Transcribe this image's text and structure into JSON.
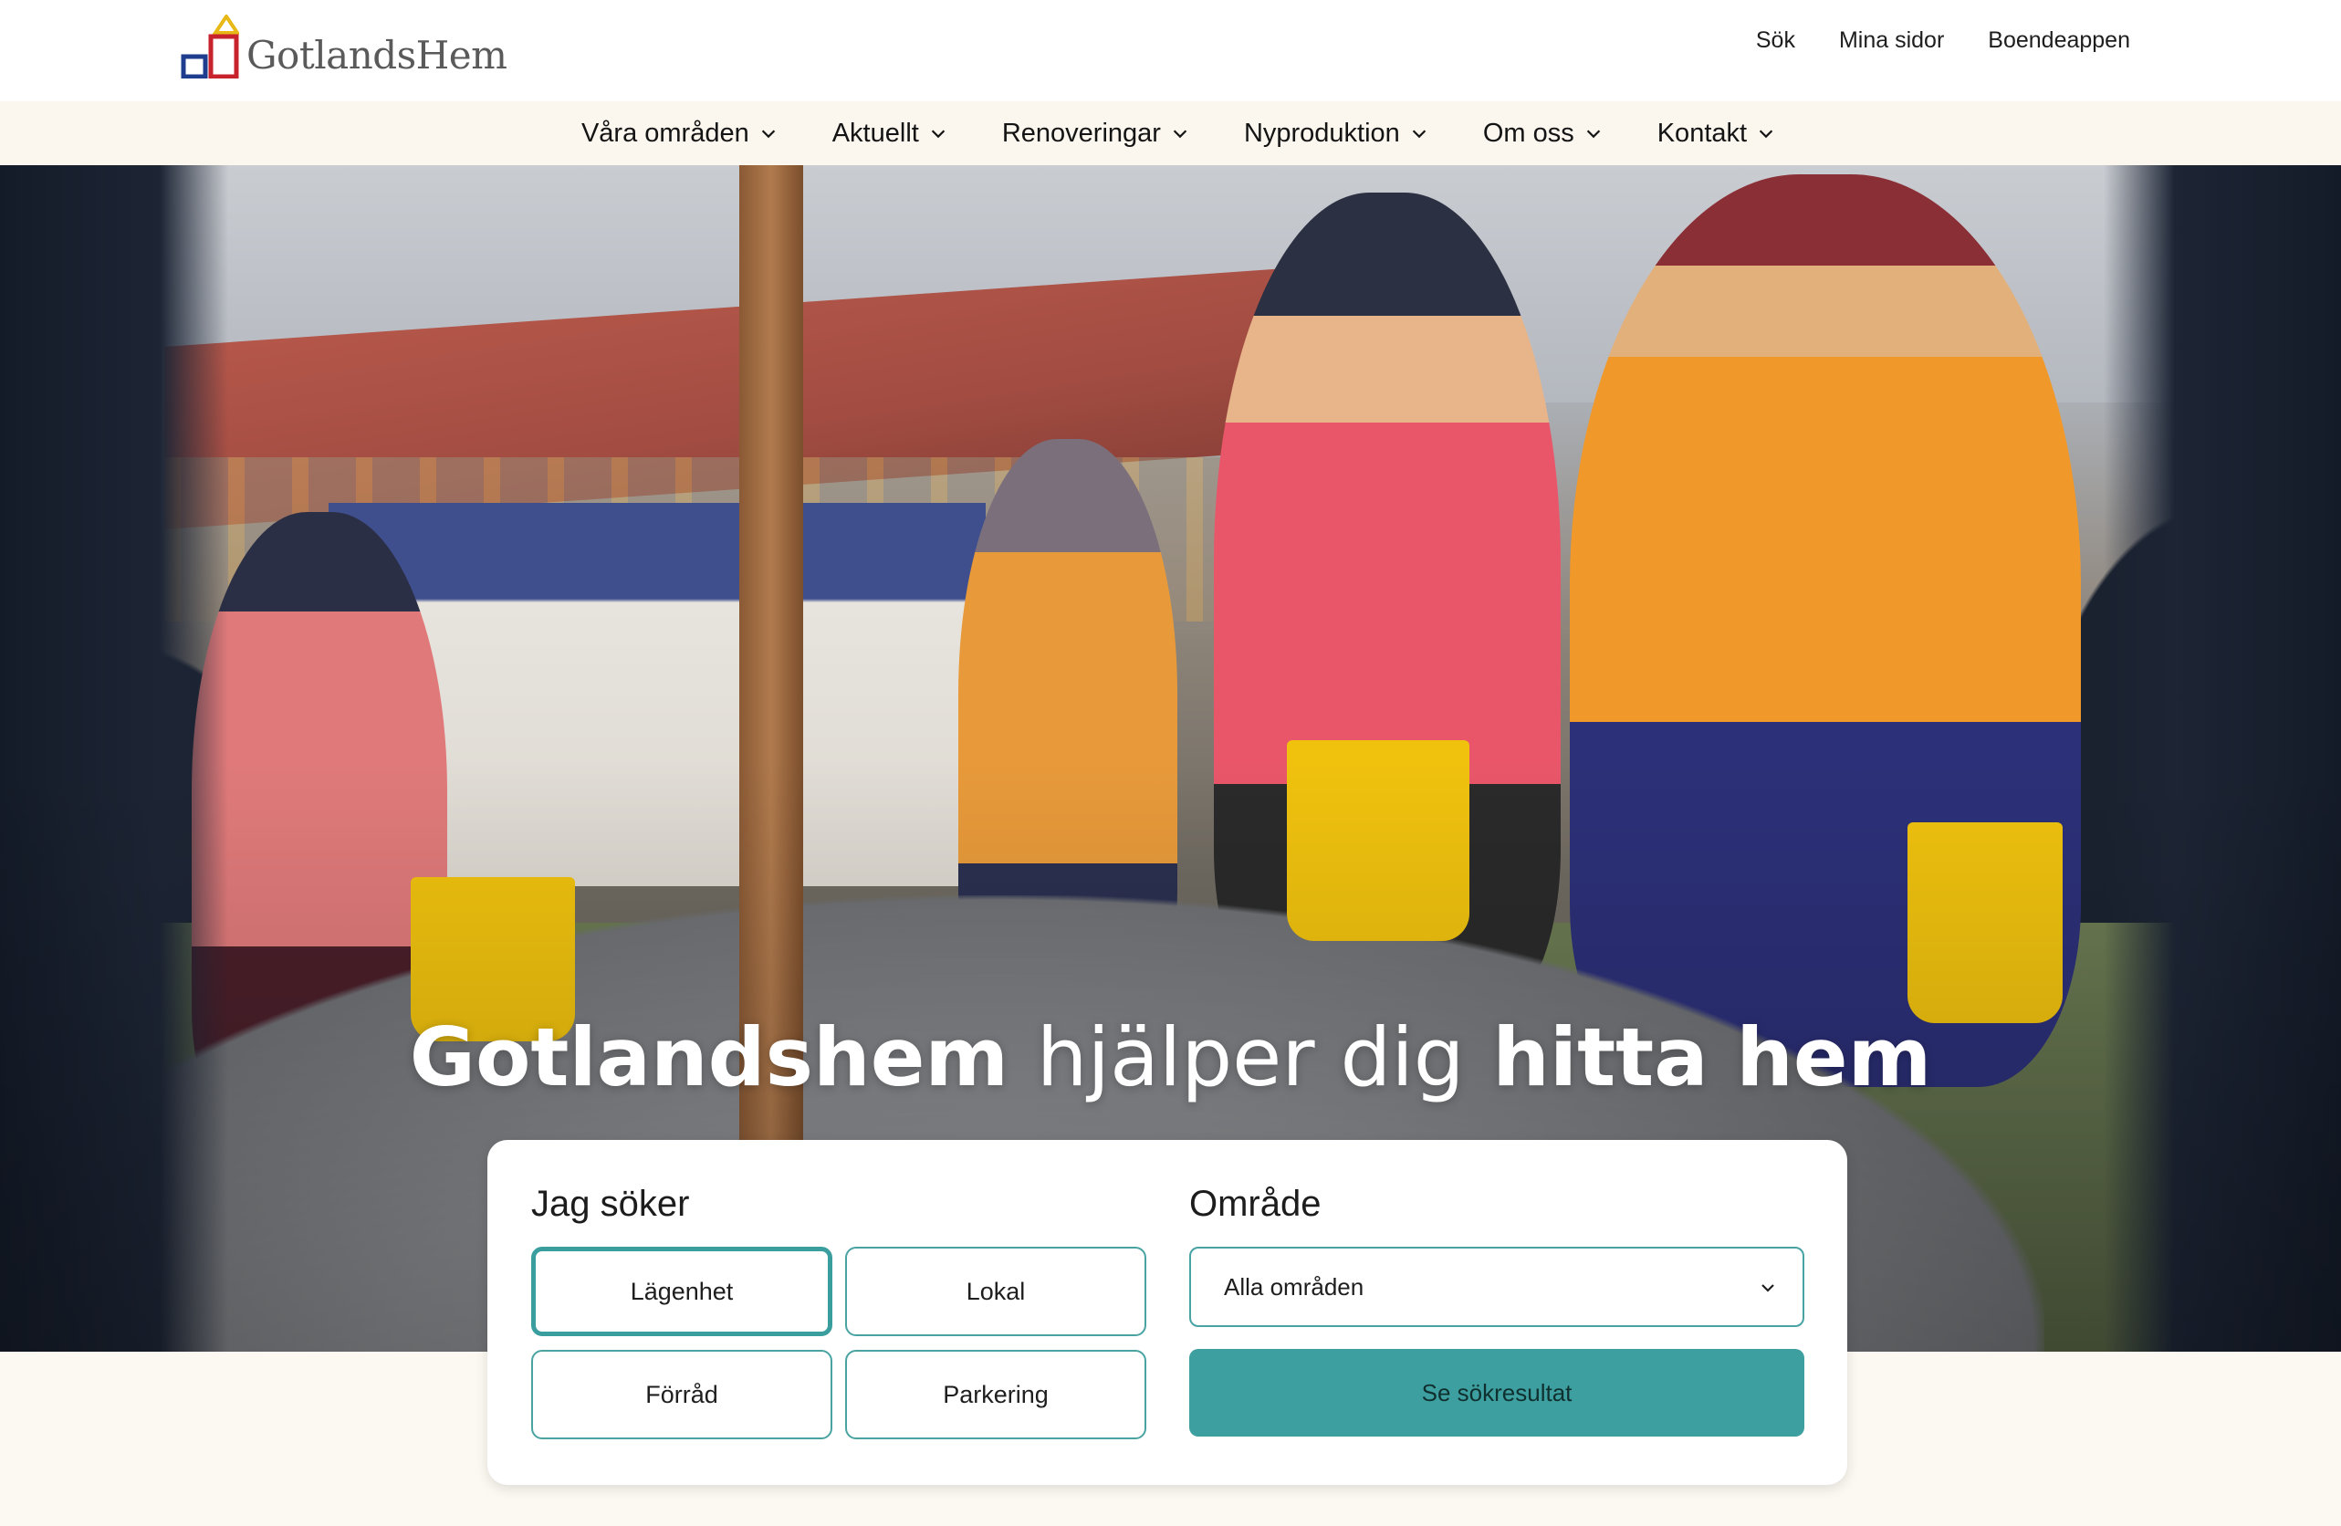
{
  "brand": {
    "logo_text": "GotlandsHem",
    "colors": {
      "accent": "#3e9fa0",
      "logo_blue": "#1f3d8f",
      "logo_red": "#c8232c",
      "logo_yellow": "#e8b916"
    }
  },
  "utility_nav": {
    "items": [
      {
        "label": "Sök"
      },
      {
        "label": "Mina sidor"
      },
      {
        "label": "Boendeappen"
      }
    ]
  },
  "main_nav": {
    "items": [
      {
        "label": "Våra områden",
        "icon": "chevron-down-icon"
      },
      {
        "label": "Aktuellt",
        "icon": "chevron-down-icon"
      },
      {
        "label": "Renoveringar",
        "icon": "chevron-down-icon"
      },
      {
        "label": "Nyproduktion",
        "icon": "chevron-down-icon"
      },
      {
        "label": "Om oss",
        "icon": "chevron-down-icon"
      },
      {
        "label": "Kontakt",
        "icon": "chevron-down-icon"
      }
    ]
  },
  "hero": {
    "title_part1": "Gotlandshem",
    "title_part2": "hjälper dig",
    "title_part3": "hitta hem"
  },
  "search": {
    "type_heading": "Jag söker",
    "area_heading": "Område",
    "types": [
      {
        "label": "Lägenhet",
        "selected": true
      },
      {
        "label": "Lokal",
        "selected": false
      },
      {
        "label": "Förråd",
        "selected": false
      },
      {
        "label": "Parkering",
        "selected": false
      }
    ],
    "area_selected": "Alla områden",
    "submit_label": "Se sökresultat"
  }
}
